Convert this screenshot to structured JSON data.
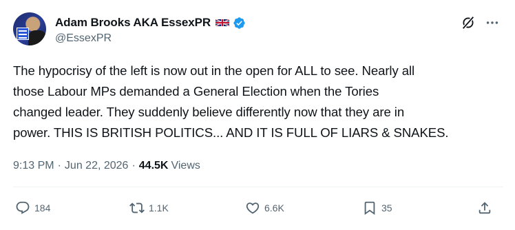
{
  "author": {
    "display_name": "Adam Brooks AKA EssexPR",
    "handle": "@EssexPR"
  },
  "tweet": {
    "text": "The hypocrisy of the left is now out in the open for ALL to see.  Nearly all\nthose Labour MPs demanded a General Election when the Tories\nchanged leader. They suddenly believe differently now that they are in\npower. THIS IS BRITISH POLITICS... AND IT IS FULL OF LIARS & SNAKES."
  },
  "meta": {
    "time": "9:13 PM",
    "separator": "·",
    "date": "Jun 22, 2026",
    "views_count": "44.5K",
    "views_label": "Views"
  },
  "actions": {
    "replies": "184",
    "reposts": "1.1K",
    "likes": "6.6K",
    "bookmarks": "35"
  },
  "colors": {
    "text_primary": "#0f1419",
    "text_secondary": "#536471",
    "verified_blue": "#1d9bf0",
    "divider": "#eff3f4"
  },
  "icons": [
    "verified-badge-icon",
    "uk-flag-icon",
    "grok-icon",
    "more-icon",
    "reply-icon",
    "repost-icon",
    "like-icon",
    "bookmark-icon",
    "share-icon"
  ]
}
